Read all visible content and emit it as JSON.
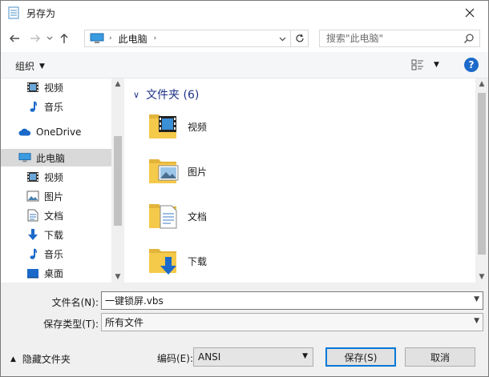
{
  "window": {
    "title": "另存为"
  },
  "address": {
    "location": "此电脑",
    "search_placeholder": "搜索\"此电脑\""
  },
  "commandbar": {
    "organize_label": "组织"
  },
  "sidebar": {
    "items": [
      {
        "label": "视频",
        "icon": "video-icon"
      },
      {
        "label": "音乐",
        "icon": "music-icon"
      },
      {
        "label": "OneDrive",
        "icon": "cloud-icon"
      },
      {
        "label": "此电脑",
        "icon": "computer-icon"
      },
      {
        "label": "视频",
        "icon": "video-icon"
      },
      {
        "label": "图片",
        "icon": "picture-icon"
      },
      {
        "label": "文档",
        "icon": "document-icon"
      },
      {
        "label": "下载",
        "icon": "download-icon"
      },
      {
        "label": "音乐",
        "icon": "music-icon"
      },
      {
        "label": "桌面",
        "icon": "desktop-icon"
      }
    ],
    "selected_index": 3
  },
  "content": {
    "group_title": "文件夹 (6)",
    "folders": [
      {
        "label": "视频",
        "icon": "video-folder-icon"
      },
      {
        "label": "图片",
        "icon": "picture-folder-icon"
      },
      {
        "label": "文档",
        "icon": "document-folder-icon"
      },
      {
        "label": "下载",
        "icon": "download-folder-icon"
      }
    ]
  },
  "form": {
    "filename_label": "文件名(N):",
    "filename_value": "一键锁屏.vbs",
    "filetype_label": "保存类型(T):",
    "filetype_value": "所有文件",
    "hide_folders_label": "隐藏文件夹",
    "encoding_label": "编码(E):",
    "encoding_value": "ANSI",
    "save_label": "保存(S)",
    "cancel_label": "取消"
  },
  "colors": {
    "accent": "#0078d7",
    "link_blue": "#1e3287",
    "folder_yellow": "#f5c94a"
  }
}
